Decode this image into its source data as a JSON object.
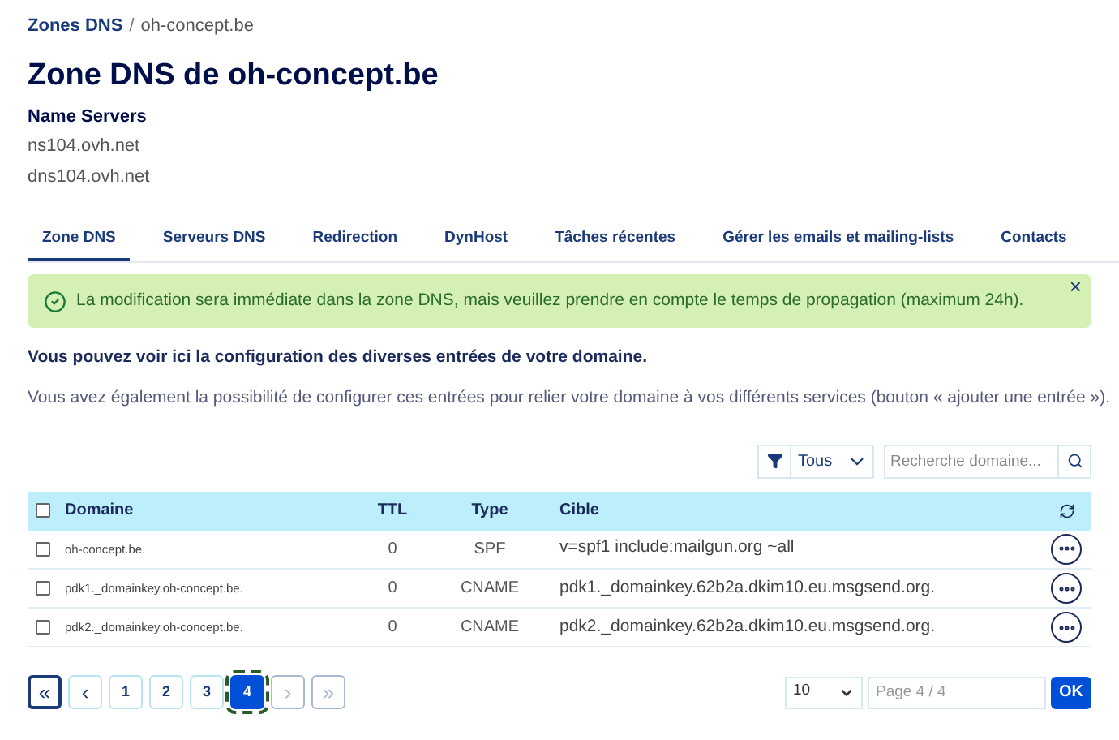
{
  "breadcrumb": {
    "separator": "/",
    "items": [
      {
        "label": "Zones DNS",
        "link": true
      },
      {
        "label": "oh-concept.be",
        "link": false
      }
    ]
  },
  "title": "Zone DNS de oh-concept.be",
  "name_servers": {
    "heading": "Name Servers",
    "items": [
      "ns104.ovh.net",
      "dns104.ovh.net"
    ]
  },
  "tabs": [
    {
      "label": "Zone DNS",
      "selected": true
    },
    {
      "label": "Serveurs DNS",
      "selected": false
    },
    {
      "label": "Redirection",
      "selected": false
    },
    {
      "label": "DynHost",
      "selected": false
    },
    {
      "label": "Tâches récentes",
      "selected": false
    },
    {
      "label": "Gérer les emails et mailing-lists",
      "selected": false
    },
    {
      "label": "Contacts",
      "selected": false
    }
  ],
  "alert": {
    "message": "La modification sera immédiate dans la zone DNS, mais veuillez prendre en compte le temps de propagation (maximum 24h).",
    "close": "×"
  },
  "intro": "Vous pouvez voir ici la configuration des diverses entrées de votre domaine.",
  "description": "Vous avez également la possibilité de configurer ces entrées pour relier votre domaine à vos différents services (bouton « ajouter une entrée »).",
  "filter": {
    "value": "Tous",
    "search_placeholder": "Recherche domaine..."
  },
  "table": {
    "select_all_checked": false,
    "columns": [
      "Domaine",
      "TTL",
      "Type",
      "Cible"
    ],
    "rows": [
      {
        "checked": false,
        "cells": [
          "oh-concept.be.",
          "0",
          "SPF",
          "v=spf1 include:mailgun.org ~all"
        ]
      },
      {
        "checked": false,
        "cells": [
          "pdk1._domainkey.oh-concept.be.",
          "0",
          "CNAME",
          "pdk1._domainkey.62b2a.dkim10.eu.msgsend.org."
        ]
      },
      {
        "checked": false,
        "cells": [
          "pdk2._domainkey.oh-concept.be.",
          "0",
          "CNAME",
          "pdk2._domainkey.62b2a.dkim10.eu.msgsend.org."
        ]
      }
    ]
  },
  "pagination": {
    "first": {
      "label": "«",
      "disabled": false
    },
    "prev": {
      "label": "‹",
      "disabled": false
    },
    "pages": [
      {
        "label": "1",
        "selected": false
      },
      {
        "label": "2",
        "selected": false
      },
      {
        "label": "3",
        "selected": false
      },
      {
        "label": "4",
        "selected": true
      }
    ],
    "next": {
      "label": "›",
      "disabled": true
    },
    "last": {
      "label": "»",
      "disabled": true
    },
    "page_size": "10",
    "page_placeholder": "Page 4 / 4",
    "ok": "OK"
  }
}
